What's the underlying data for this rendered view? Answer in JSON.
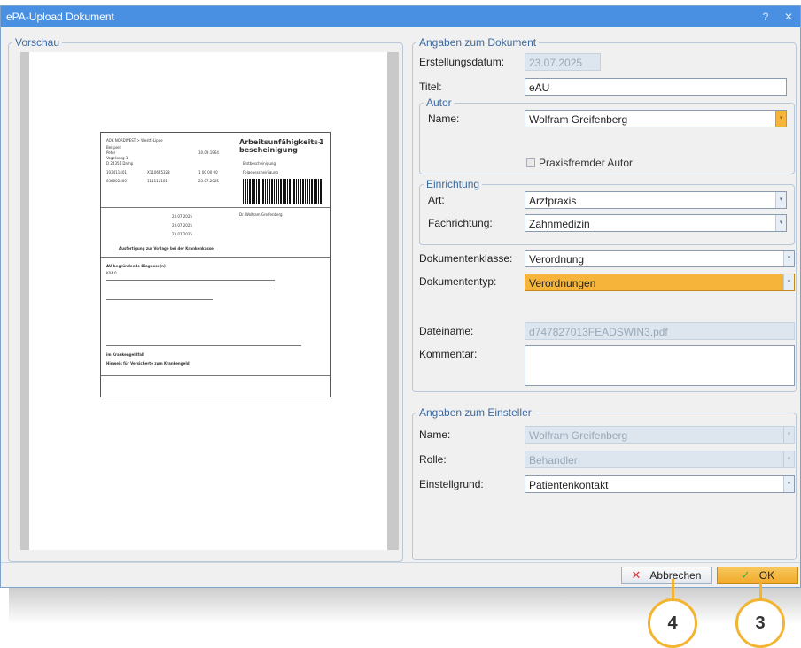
{
  "window": {
    "title": "ePA-Upload Dokument",
    "help": "?",
    "close": "✕"
  },
  "vorschau": {
    "legend": "Vorschau"
  },
  "document_preview": {
    "heading": "Arbeitsunfähigkeits- bescheinigung",
    "number": "1",
    "insurer": "AOK NORDWEST > Westf.-Lippe",
    "name_line": "Beispiel",
    "first_name": "Peter",
    "address": "Vogelsang 1",
    "city": "D 24351 Damp",
    "birth_date": "10.09.1964",
    "id_1": "103411401",
    "id_2": "X110645328",
    "id_3": "1 00 00 00",
    "id_4": "036002400",
    "id_5": "111111101",
    "id_6": "23.07.2025",
    "first_cert": "Erstbescheinigung",
    "followup_cert": "Folgebescheinigung",
    "date_1": "23.07.2025",
    "date_2": "23.07.2025",
    "date_3": "23.07.2025",
    "doctor_block": "Dr. Wolfram Greifenberg",
    "footer_note": "Ausfertigung zur Vorlage bei der Krankenkasse",
    "diag_title": "AU-begründende Diagnose(n)",
    "diag_code": "K04.0",
    "sick_pay": "im Krankengeldfall",
    "notice": "Hinweis für Versicherte zum Krankengeld"
  },
  "angaben_dokument": {
    "legend": "Angaben zum Dokument",
    "erstellungsdatum_label": "Erstellungsdatum:",
    "erstellungsdatum_value": "23.07.2025",
    "titel_label": "Titel:",
    "titel_value": "eAU",
    "autor_legend": "Autor",
    "name_label": "Name:",
    "name_value": "Wolfram Greifenberg",
    "praxisfremder_label": "Praxisfremder Autor",
    "einrichtung_legend": "Einrichtung",
    "art_label": "Art:",
    "art_value": "Arztpraxis",
    "fachrichtung_label": "Fachrichtung:",
    "fachrichtung_value": "Zahnmedizin",
    "dokumentenklasse_label": "Dokumentenklasse:",
    "dokumentenklasse_value": "Verordnung",
    "dokumententyp_label": "Dokumententyp:",
    "dokumententyp_value": "Verordnungen",
    "dateiname_label": "Dateiname:",
    "dateiname_value": "d747827013FEADSWIN3.pdf",
    "kommentar_label": "Kommentar:",
    "kommentar_value": ""
  },
  "angaben_einsteller": {
    "legend": "Angaben zum Einsteller",
    "name_label": "Name:",
    "name_value": "Wolfram Greifenberg",
    "rolle_label": "Rolle:",
    "rolle_value": "Behandler",
    "einstellgrund_label": "Einstellgrund:",
    "einstellgrund_value": "Patientenkontakt"
  },
  "buttons": {
    "cancel": "Abbrechen",
    "ok": "OK"
  },
  "callouts": {
    "cancel_step": "4",
    "ok_step": "3"
  },
  "colors": {
    "titlebar": "#4a90e2",
    "highlight": "#f6b53a",
    "callout": "#f2b431"
  }
}
